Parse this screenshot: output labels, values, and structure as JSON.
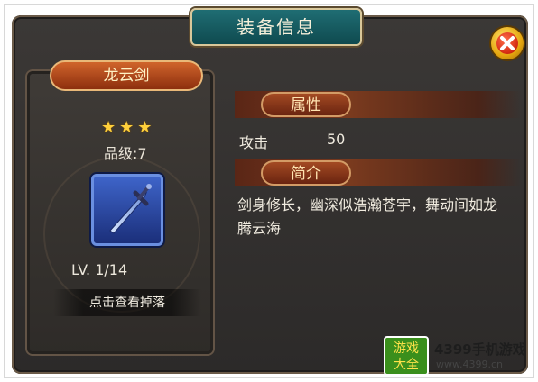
{
  "window": {
    "title": "装备信息"
  },
  "close_icon": "close-icon",
  "item": {
    "name": "龙云剑",
    "stars": [
      "★",
      "★",
      "★"
    ],
    "grade_text": "品级:7",
    "level_text": "LV. 1/14",
    "drop_button_label": "点击查看掉落",
    "icon": "sword-icon"
  },
  "sections": {
    "attributes": {
      "title": "属性",
      "rows": [
        {
          "label": "攻击",
          "value": "50"
        }
      ]
    },
    "intro": {
      "title": "简介",
      "text": "剑身修长，幽深似浩瀚苍宇，舞动间如龙腾云海"
    }
  },
  "watermark": {
    "logo_line1": "游戏",
    "logo_line2": "大全",
    "title": "4399手机游戏",
    "url": "www.4399.cn"
  },
  "colors": {
    "star": "#ffd03b",
    "name_plate": "#c05a26",
    "title_plate": "#1f6d73",
    "section_tab": "#a34a23"
  }
}
